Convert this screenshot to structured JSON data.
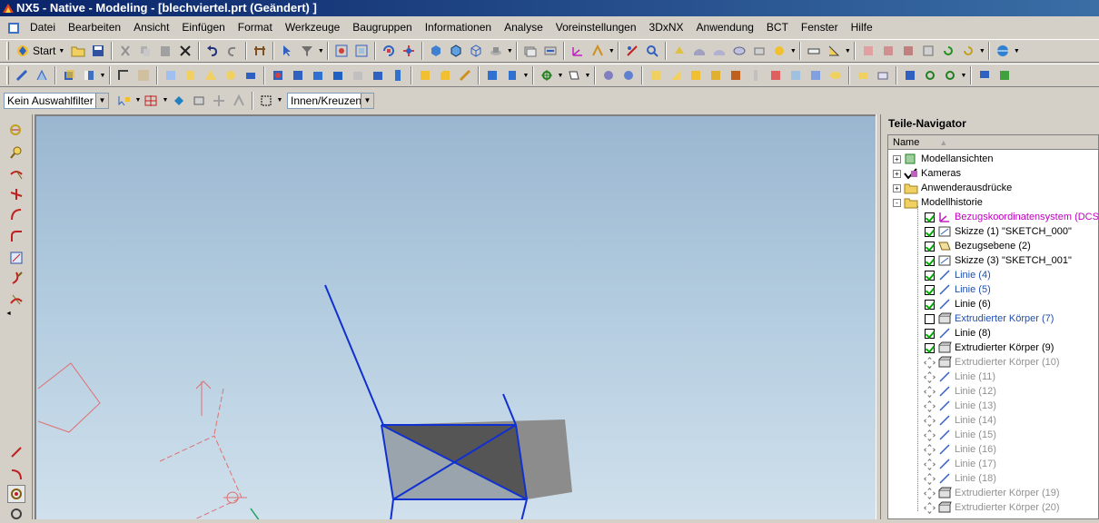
{
  "window": {
    "title": "NX5 - Native - Modeling - [blechviertel.prt (Geändert) ]"
  },
  "menu": {
    "items": [
      "Datei",
      "Bearbeiten",
      "Ansicht",
      "Einfügen",
      "Format",
      "Werkzeuge",
      "Baugruppen",
      "Informationen",
      "Analyse",
      "Voreinstellungen",
      "3DxNX",
      "Anwendung",
      "BCT",
      "Fenster",
      "Hilfe"
    ]
  },
  "toolbar": {
    "start_label": "Start"
  },
  "selection_bar": {
    "filter_value": "Kein Auswahlfilter",
    "mode_value": "Innen/Kreuzen"
  },
  "navigator": {
    "title": "Teile-Navigator",
    "column_name": "Name",
    "nodes": [
      {
        "label": "Modellansichten",
        "style": "black",
        "expander": "+",
        "check": "none"
      },
      {
        "label": "Kameras",
        "style": "black",
        "expander": "+",
        "check": "none"
      },
      {
        "label": "Anwenderausdrücke",
        "style": "black",
        "expander": "+",
        "check": "none"
      },
      {
        "label": "Modellhistorie",
        "style": "black",
        "expander": "-",
        "check": "none"
      },
      {
        "label": "Bezugskoordinatensystem (DCS...",
        "style": "magenta",
        "check": "on"
      },
      {
        "label": "Skizze (1) \"SKETCH_000\"",
        "style": "black",
        "check": "on"
      },
      {
        "label": "Bezugsebene (2)",
        "style": "black",
        "check": "on"
      },
      {
        "label": "Skizze (3) \"SKETCH_001\"",
        "style": "black",
        "check": "on"
      },
      {
        "label": "Linie (4)",
        "style": "blue",
        "check": "on"
      },
      {
        "label": "Linie (5)",
        "style": "blue",
        "check": "on"
      },
      {
        "label": "Linie (6)",
        "style": "black",
        "check": "on"
      },
      {
        "label": "Extrudierter Körper (7)",
        "style": "blue",
        "check": "off"
      },
      {
        "label": "Linie (8)",
        "style": "black",
        "check": "on"
      },
      {
        "label": "Extrudierter Körper (9)",
        "style": "black",
        "check": "on"
      },
      {
        "label": "Extrudierter Körper (10)",
        "style": "gray",
        "check": "dashed"
      },
      {
        "label": "Linie (11)",
        "style": "gray",
        "check": "dashed"
      },
      {
        "label": "Linie (12)",
        "style": "gray",
        "check": "dashed"
      },
      {
        "label": "Linie (13)",
        "style": "gray",
        "check": "dashed"
      },
      {
        "label": "Linie (14)",
        "style": "gray",
        "check": "dashed"
      },
      {
        "label": "Linie (15)",
        "style": "gray",
        "check": "dashed"
      },
      {
        "label": "Linie (16)",
        "style": "gray",
        "check": "dashed"
      },
      {
        "label": "Linie (17)",
        "style": "gray",
        "check": "dashed"
      },
      {
        "label": "Linie (18)",
        "style": "gray",
        "check": "dashed"
      },
      {
        "label": "Extrudierter Körper (19)",
        "style": "gray",
        "check": "dashed"
      },
      {
        "label": "Extrudierter Körper (20)",
        "style": "gray",
        "check": "dashed"
      }
    ]
  },
  "colors": {
    "title_bar": "#0a246a",
    "viewport_top": "#9ab6d0",
    "viewport_bottom": "#d0e0ec",
    "geometry_lines": "#1030d0",
    "solid_face": "#555555",
    "sketch_red": "#e07070"
  }
}
